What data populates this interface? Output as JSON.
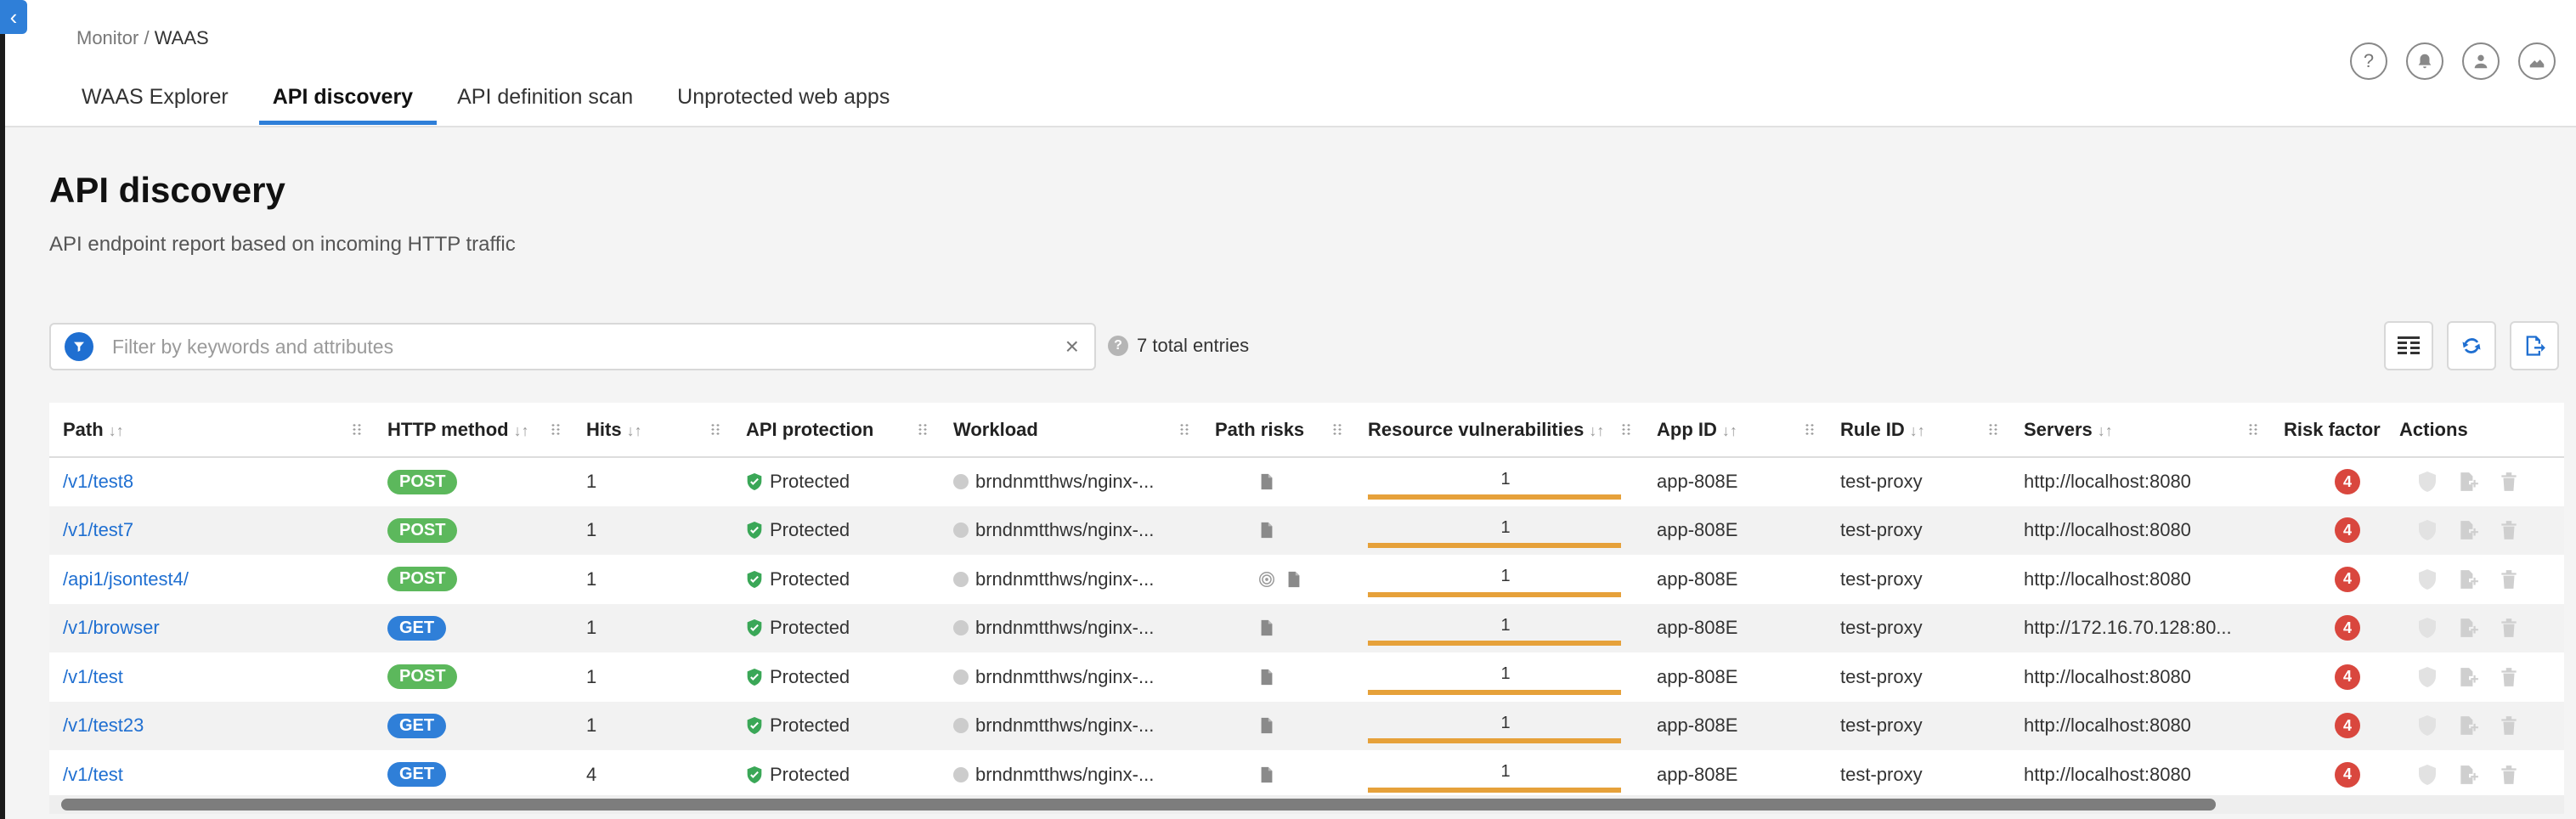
{
  "breadcrumb": {
    "parent": "Monitor",
    "separator": " / ",
    "current": "WAAS"
  },
  "tabs": [
    {
      "label": "WAAS Explorer",
      "active": false
    },
    {
      "label": "API discovery",
      "active": true
    },
    {
      "label": "API definition scan",
      "active": false
    },
    {
      "label": "Unprotected web apps",
      "active": false
    }
  ],
  "top_icons": [
    "help-icon",
    "bell-icon",
    "user-icon",
    "chart-icon"
  ],
  "page": {
    "title": "API discovery",
    "subtitle": "API endpoint report based on incoming HTTP traffic"
  },
  "filter": {
    "placeholder": "Filter by keywords and attributes",
    "value": ""
  },
  "entries": {
    "label": "7 total entries"
  },
  "toolbar": [
    "columns-icon",
    "refresh-icon",
    "export-icon"
  ],
  "colors": {
    "accent": "#2f7fd8",
    "post": "#5cb85c",
    "get": "#2f7fd8",
    "protected": "#3aa757",
    "vuln_bar": "#e6a13a",
    "risk": "#d9473e"
  },
  "table": {
    "headers": [
      "Path",
      "HTTP method",
      "Hits",
      "API protection",
      "Workload",
      "Path risks",
      "Resource vulnerabilities",
      "App ID",
      "Rule ID",
      "Servers",
      "Risk factor",
      "Actions"
    ],
    "rows": [
      {
        "path": "/v1/test8",
        "method": "POST",
        "hits": "1",
        "protection": "Protected",
        "workload": "brndnmtthws/nginx-...",
        "path_risks": [
          "file-icon"
        ],
        "vuln": "1",
        "app_id": "app-808E",
        "rule_id": "test-proxy",
        "server": "http://localhost:8080",
        "risk": "4"
      },
      {
        "path": "/v1/test7",
        "method": "POST",
        "hits": "1",
        "protection": "Protected",
        "workload": "brndnmtthws/nginx-...",
        "path_risks": [
          "file-icon"
        ],
        "vuln": "1",
        "app_id": "app-808E",
        "rule_id": "test-proxy",
        "server": "http://localhost:8080",
        "risk": "4"
      },
      {
        "path": "/api1/jsontest4/",
        "method": "POST",
        "hits": "1",
        "protection": "Protected",
        "workload": "brndnmtthws/nginx-...",
        "path_risks": [
          "fingerprint-icon",
          "file-icon"
        ],
        "vuln": "1",
        "app_id": "app-808E",
        "rule_id": "test-proxy",
        "server": "http://localhost:8080",
        "risk": "4"
      },
      {
        "path": "/v1/browser",
        "method": "GET",
        "hits": "1",
        "protection": "Protected",
        "workload": "brndnmtthws/nginx-...",
        "path_risks": [
          "file-icon"
        ],
        "vuln": "1",
        "app_id": "app-808E",
        "rule_id": "test-proxy",
        "server": "http://172.16.70.128:80...",
        "risk": "4"
      },
      {
        "path": "/v1/test",
        "method": "POST",
        "hits": "1",
        "protection": "Protected",
        "workload": "brndnmtthws/nginx-...",
        "path_risks": [
          "file-icon"
        ],
        "vuln": "1",
        "app_id": "app-808E",
        "rule_id": "test-proxy",
        "server": "http://localhost:8080",
        "risk": "4"
      },
      {
        "path": "/v1/test23",
        "method": "GET",
        "hits": "1",
        "protection": "Protected",
        "workload": "brndnmtthws/nginx-...",
        "path_risks": [
          "file-icon"
        ],
        "vuln": "1",
        "app_id": "app-808E",
        "rule_id": "test-proxy",
        "server": "http://localhost:8080",
        "risk": "4"
      },
      {
        "path": "/v1/test",
        "method": "GET",
        "hits": "4",
        "protection": "Protected",
        "workload": "brndnmtthws/nginx-...",
        "path_risks": [
          "file-icon"
        ],
        "vuln": "1",
        "app_id": "app-808E",
        "rule_id": "test-proxy",
        "server": "http://localhost:8080",
        "risk": "4"
      }
    ]
  }
}
